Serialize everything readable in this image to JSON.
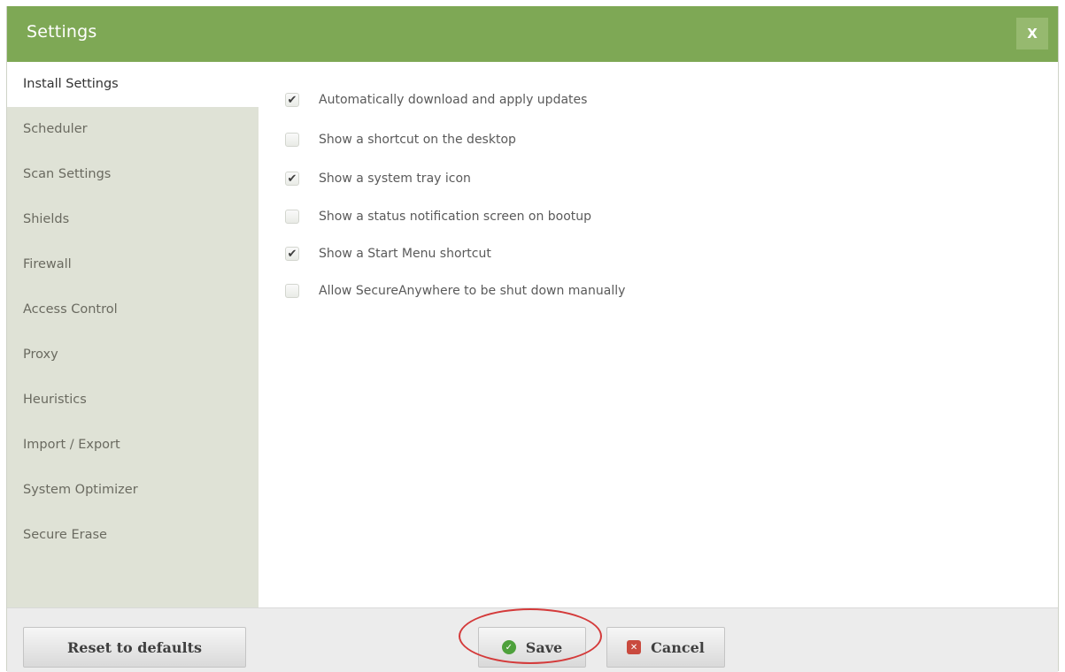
{
  "window": {
    "title": "Settings",
    "close_label": "X"
  },
  "sidebar": {
    "items": [
      {
        "label": "Install Settings",
        "active": true
      },
      {
        "label": "Scheduler"
      },
      {
        "label": "Scan Settings"
      },
      {
        "label": "Shields"
      },
      {
        "label": "Firewall"
      },
      {
        "label": "Access Control"
      },
      {
        "label": "Proxy"
      },
      {
        "label": "Heuristics"
      },
      {
        "label": "Import / Export"
      },
      {
        "label": "System Optimizer"
      },
      {
        "label": "Secure Erase"
      }
    ]
  },
  "options": [
    {
      "label": "Automatically download and apply updates",
      "checked": true
    },
    {
      "label": "Show a shortcut on the desktop",
      "checked": false
    },
    {
      "label": "Show a system tray icon",
      "checked": true
    },
    {
      "label": "Show a status notification screen on bootup",
      "checked": false
    },
    {
      "label": "Show a Start Menu shortcut",
      "checked": true
    },
    {
      "label": "Allow SecureAnywhere to be shut down manually",
      "checked": false
    }
  ],
  "footer": {
    "reset_label": "Reset to defaults",
    "save_label": "Save",
    "cancel_label": "Cancel"
  },
  "icons": {
    "save": "check-circle-icon",
    "cancel": "x-square-icon",
    "checkbox_check": "checkmark-icon"
  },
  "colors": {
    "titlebar": "#7ea855",
    "sidebar": "#dfe2d6",
    "highlight_ring": "#d43a3a",
    "save_icon": "#4ea13c",
    "cancel_icon": "#c94a3e"
  }
}
